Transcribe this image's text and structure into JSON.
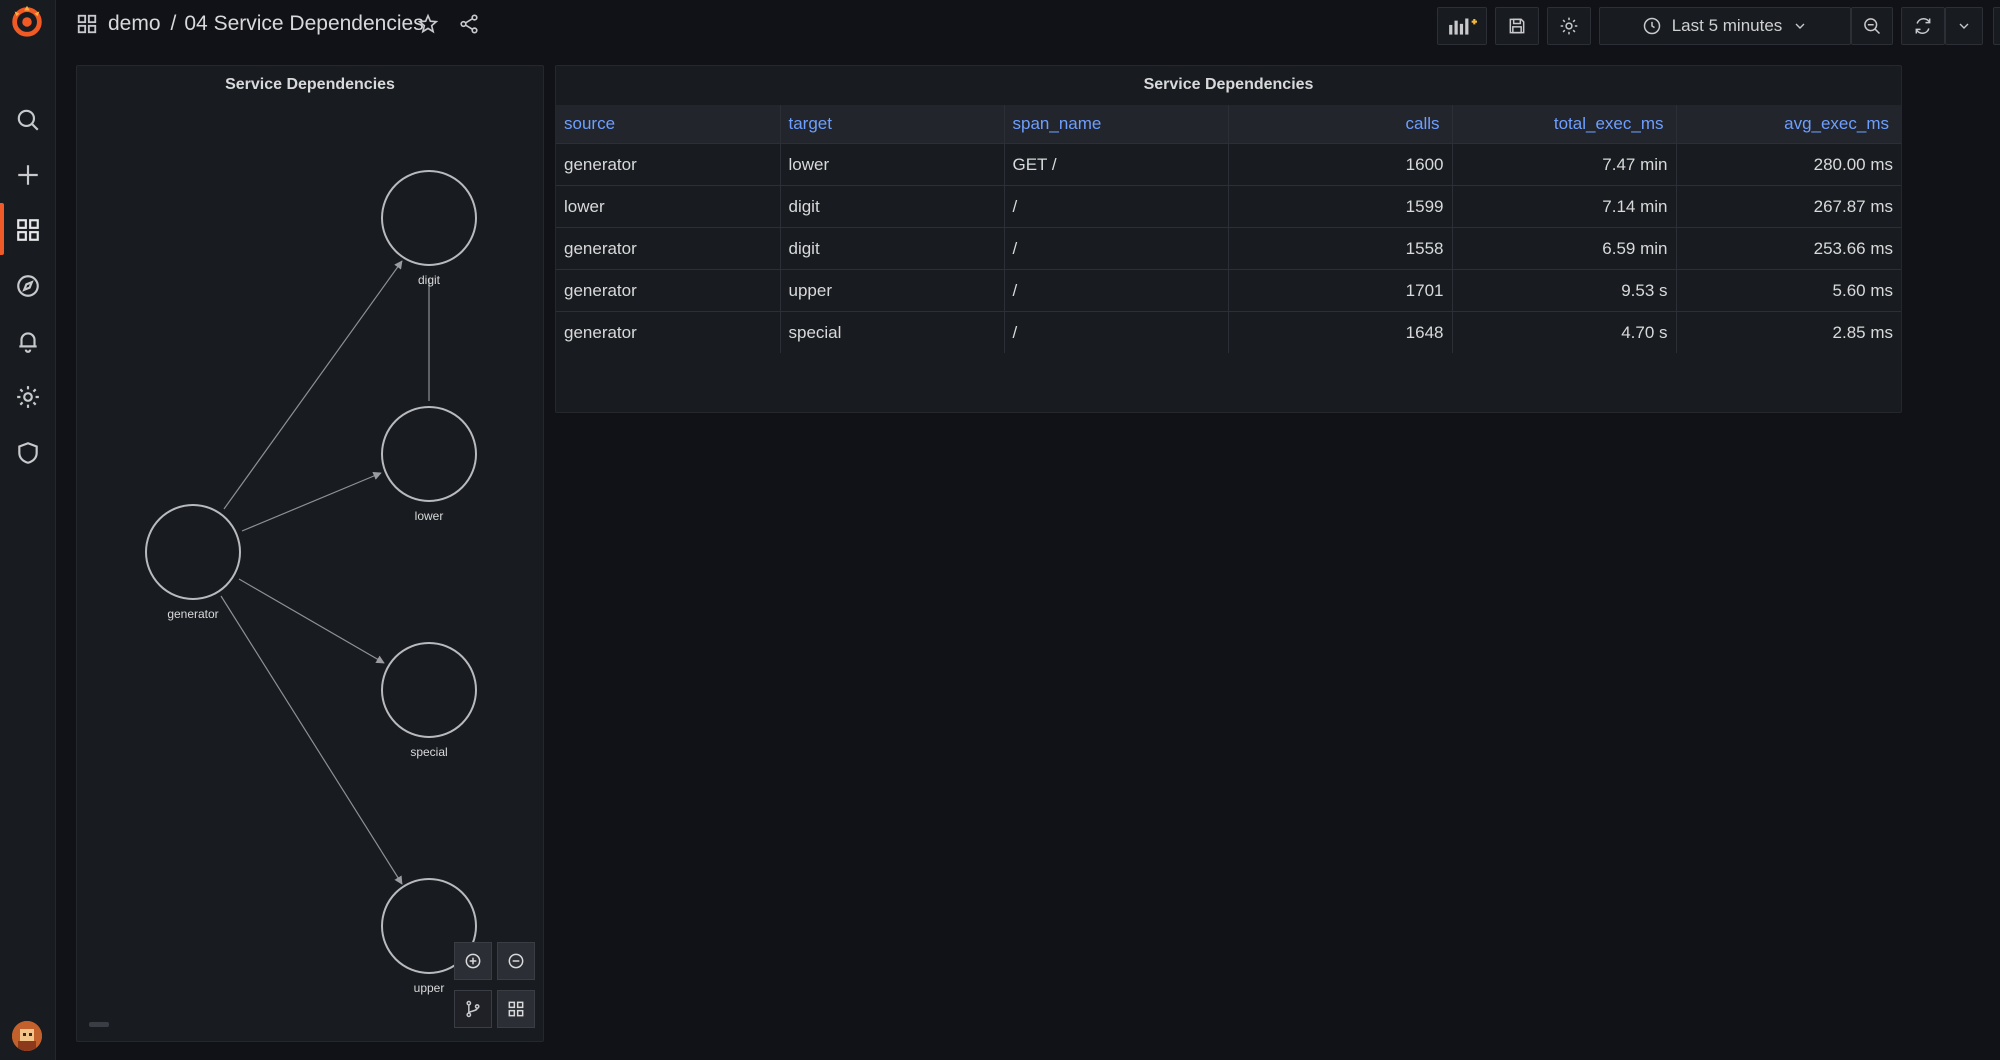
{
  "breadcrumb": {
    "folder": "demo",
    "separator": "/",
    "dashboard": "04 Service Dependencies"
  },
  "toolbar": {
    "time_range": "Last 5 minutes"
  },
  "graph_panel": {
    "title": "Service Dependencies",
    "nodes": [
      "digit",
      "lower",
      "generator",
      "special",
      "upper"
    ]
  },
  "table_panel": {
    "title": "Service Dependencies",
    "columns": [
      "source",
      "target",
      "span_name",
      "calls",
      "total_exec_ms",
      "avg_exec_ms"
    ],
    "rows": [
      [
        "generator",
        "lower",
        "GET /",
        "1600",
        "7.47 min",
        "280.00 ms"
      ],
      [
        "lower",
        "digit",
        "/",
        "1599",
        "7.14 min",
        "267.87 ms"
      ],
      [
        "generator",
        "digit",
        "/",
        "1558",
        "6.59 min",
        "253.66 ms"
      ],
      [
        "generator",
        "upper",
        "/",
        "1701",
        "9.53 s",
        "5.60 ms"
      ],
      [
        "generator",
        "special",
        "/",
        "1648",
        "4.70 s",
        "2.85 ms"
      ]
    ]
  },
  "colors": {
    "accent": "#f05a28",
    "link": "#6e9fff",
    "background": "#111217",
    "panel": "#181b1f"
  }
}
